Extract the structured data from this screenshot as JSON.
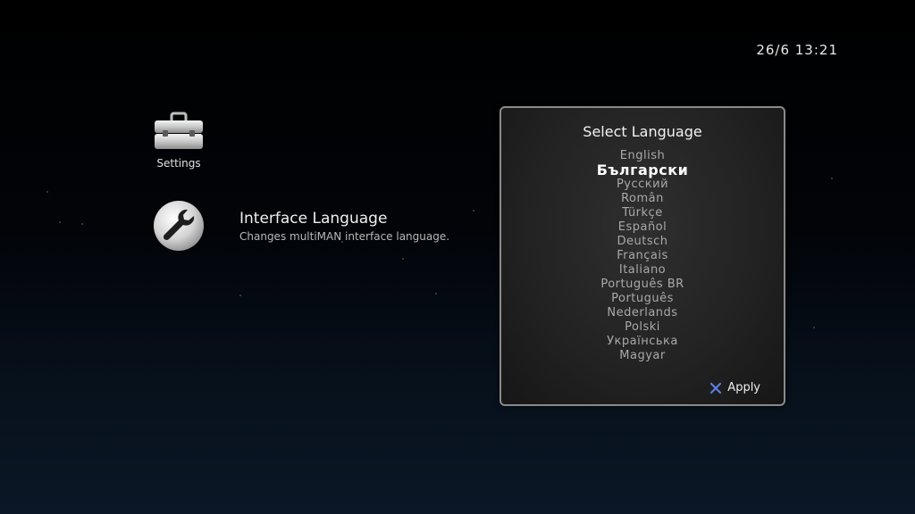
{
  "status": {
    "clock": "26/6 13:21"
  },
  "category": {
    "icon": "toolbox-icon",
    "label": "Settings"
  },
  "item": {
    "icon": "wrench-icon",
    "title": "Interface Language",
    "description": "Changes multiMAN interface language."
  },
  "dialog": {
    "title": "Select Language",
    "selected_index": 1,
    "languages": [
      "English",
      "Български",
      "Русский",
      "Român",
      "Türkçe",
      "Español",
      "Deutsch",
      "Français",
      "Italiano",
      "Português BR",
      "Português",
      "Nederlands",
      "Polski",
      "Українська",
      "Magyar"
    ],
    "apply_label": "Apply",
    "apply_icon": "cross-button-icon"
  },
  "colors": {
    "apply_icon": "#5b7fe0",
    "selected_text": "#ffffff",
    "unselected_text": "#a9a9a9"
  }
}
